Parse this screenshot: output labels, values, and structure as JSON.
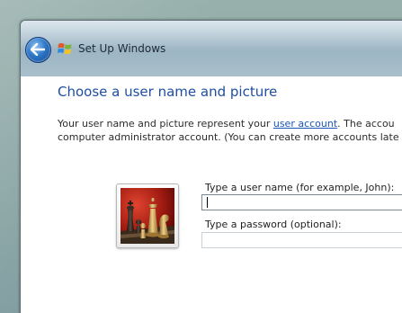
{
  "window": {
    "title": "Set Up Windows"
  },
  "page": {
    "heading": "Choose a user name and picture",
    "desc_line1_before": "Your user name and picture represent your ",
    "desc_link": "user account",
    "desc_line1_after": ". The accou",
    "desc_line2": "computer administrator account. (You can create more accounts late"
  },
  "form": {
    "username_label": "Type a user name (for example, John):",
    "username_value": "",
    "password_label": "Type a password (optional):",
    "password_value": ""
  },
  "icons": {
    "back": "back-arrow-icon",
    "logo": "windows-logo-icon",
    "picture": "chess-pieces-picture"
  },
  "colors": {
    "heading": "#1e4fa2",
    "link": "#1a56b8",
    "back_button": "#2e77c7"
  }
}
